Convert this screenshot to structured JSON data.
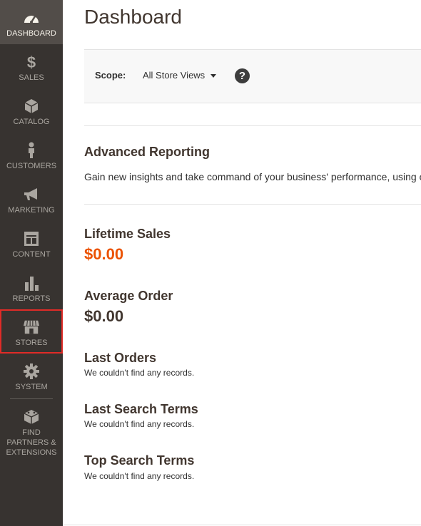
{
  "sidebar": {
    "items": [
      {
        "id": "dashboard",
        "label": "DASHBOARD",
        "icon": "gauge-icon",
        "active": true
      },
      {
        "id": "sales",
        "label": "SALES",
        "icon": "dollar-icon"
      },
      {
        "id": "catalog",
        "label": "CATALOG",
        "icon": "cube-icon"
      },
      {
        "id": "customers",
        "label": "CUSTOMERS",
        "icon": "person-icon"
      },
      {
        "id": "marketing",
        "label": "MARKETING",
        "icon": "megaphone-icon"
      },
      {
        "id": "content",
        "label": "CONTENT",
        "icon": "layout-icon"
      },
      {
        "id": "reports",
        "label": "REPORTS",
        "icon": "bar-chart-icon"
      },
      {
        "id": "stores",
        "label": "STORES",
        "icon": "storefront-icon",
        "highlighted": true
      },
      {
        "id": "system",
        "label": "SYSTEM",
        "icon": "gear-icon"
      },
      {
        "id": "partners",
        "label": "FIND PARTNERS & EXTENSIONS",
        "icon": "blocks-icon"
      }
    ]
  },
  "header": {
    "title": "Dashboard"
  },
  "scope": {
    "label": "Scope:",
    "value": "All Store Views",
    "help_icon": "?"
  },
  "advanced_reporting": {
    "title": "Advanced Reporting",
    "text": "Gain new insights and take command of your business' performance, using our dynamic product, order, and customer reports tailored to your customer data."
  },
  "lifetime_sales": {
    "title": "Lifetime Sales",
    "value": "$0.00"
  },
  "average_order": {
    "title": "Average Order",
    "value": "$0.00"
  },
  "last_orders": {
    "title": "Last Orders",
    "empty": "We couldn't find any records."
  },
  "last_search_terms": {
    "title": "Last Search Terms",
    "empty": "We couldn't find any records."
  },
  "top_search_terms": {
    "title": "Top Search Terms",
    "empty": "We couldn't find any records."
  },
  "colors": {
    "sidebar_bg": "#373330",
    "active_bg": "#524d49",
    "accent": "#eb5202",
    "highlight_border": "#e02b27"
  }
}
